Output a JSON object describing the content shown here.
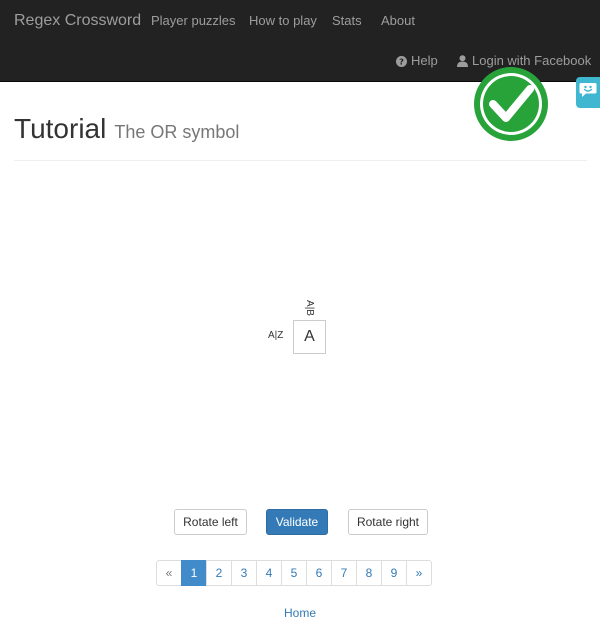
{
  "navbar": {
    "brand": "Regex Crossword",
    "links": [
      "Player puzzles",
      "How to play",
      "Stats",
      "About"
    ],
    "help_label": "Help",
    "login_label": "Login with Facebook"
  },
  "header": {
    "title": "Tutorial",
    "subtitle": "The OR symbol"
  },
  "puzzle": {
    "column_clue": "A|B",
    "row_clue": "A|Z",
    "cell_value": "A",
    "solved": true
  },
  "controls": {
    "rotate_left": "Rotate left",
    "validate": "Validate",
    "rotate_right": "Rotate right"
  },
  "pagination": {
    "prev": "«",
    "pages": [
      "1",
      "2",
      "3",
      "4",
      "5",
      "6",
      "7",
      "8",
      "9"
    ],
    "next": "»",
    "active_page": "1"
  },
  "footer": {
    "home_link": "Home"
  },
  "colors": {
    "navbar_bg": "#222222",
    "primary": "#337ab7",
    "success_check": "#27a33a",
    "feedback_tab": "#3fb7d0"
  }
}
